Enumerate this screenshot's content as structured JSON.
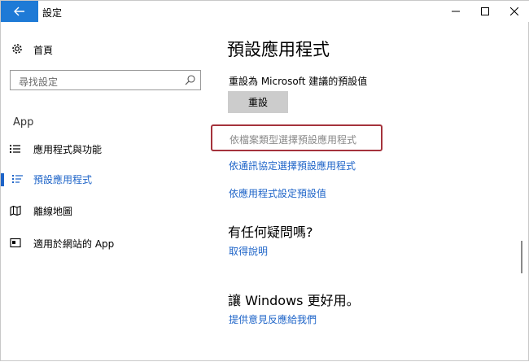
{
  "window": {
    "title": "設定"
  },
  "sidebar": {
    "home_label": "首頁",
    "search_placeholder": "尋找設定",
    "section_label": "App",
    "items": [
      {
        "label": "應用程式與功能",
        "icon": "list-icon",
        "active": false
      },
      {
        "label": "預設應用程式",
        "icon": "default-apps-icon",
        "active": true
      },
      {
        "label": "離線地圖",
        "icon": "map-icon",
        "active": false
      },
      {
        "label": "適用於網站的 App",
        "icon": "web-app-icon",
        "active": false
      }
    ]
  },
  "main": {
    "title": "預設應用程式",
    "reset_text": "重設為 Microsoft 建議的預設值",
    "reset_button": "重設",
    "links": {
      "by_file_type": "依檔案類型選擇預設應用程式",
      "by_protocol": "依通訊協定選擇預設應用程式",
      "by_app": "依應用程式設定預設值"
    },
    "question_title": "有任何疑問嗎?",
    "get_help": "取得說明",
    "feedback_title": "讓 Windows 更好用。",
    "feedback_link": "提供意見反應給我們"
  },
  "colors": {
    "accent": "#1e64c8",
    "title_back": "#1e7ad6",
    "highlight": "#a5333c"
  }
}
